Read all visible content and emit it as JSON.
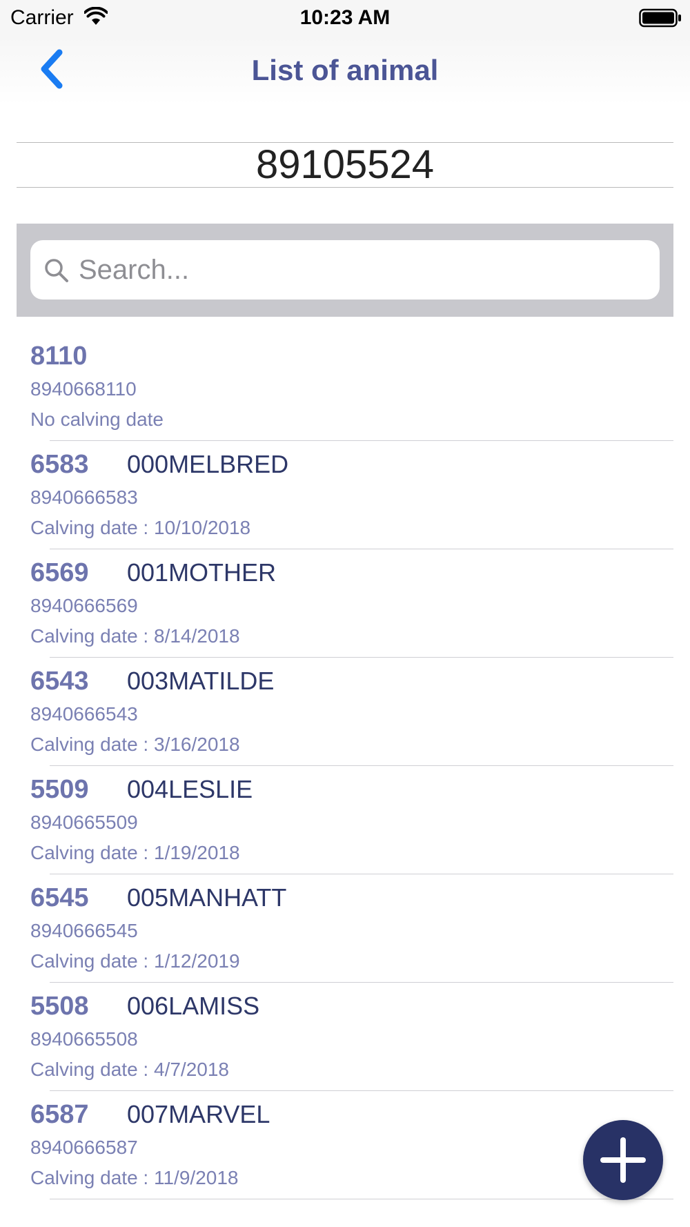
{
  "status_bar": {
    "carrier": "Carrier",
    "time": "10:23 AM",
    "wifi_icon": "wifi-icon",
    "battery_icon": "battery-icon"
  },
  "nav": {
    "title": "List of animal",
    "back_icon": "chevron-left-icon"
  },
  "herd_number": "89105524",
  "search": {
    "placeholder": "Search...",
    "value": "",
    "icon": "search-icon"
  },
  "animals": [
    {
      "number": "8110",
      "name": "",
      "tag": "8940668110",
      "calving": "No calving date"
    },
    {
      "number": "6583",
      "name": "000MELBRED",
      "tag": "8940666583",
      "calving": "Calving date : 10/10/2018"
    },
    {
      "number": "6569",
      "name": "001MOTHER",
      "tag": "8940666569",
      "calving": "Calving date : 8/14/2018"
    },
    {
      "number": "6543",
      "name": "003MATILDE",
      "tag": "8940666543",
      "calving": "Calving date : 3/16/2018"
    },
    {
      "number": "5509",
      "name": "004LESLIE",
      "tag": "8940665509",
      "calving": "Calving date : 1/19/2018"
    },
    {
      "number": "6545",
      "name": "005MANHATT",
      "tag": "8940666545",
      "calving": "Calving date : 1/12/2019"
    },
    {
      "number": "5508",
      "name": "006LAMISS",
      "tag": "8940665508",
      "calving": "Calving date : 4/7/2018"
    },
    {
      "number": "6587",
      "name": "007MARVEL",
      "tag": "8940666587",
      "calving": "Calving date : 11/9/2018"
    }
  ],
  "fab": {
    "icon": "plus-icon",
    "color": "#283266"
  },
  "colors": {
    "title": "#4b5595",
    "back": "#1a7cf2",
    "number": "#6d74ad",
    "name": "#2d3768",
    "secondary": "#7a80b3"
  }
}
